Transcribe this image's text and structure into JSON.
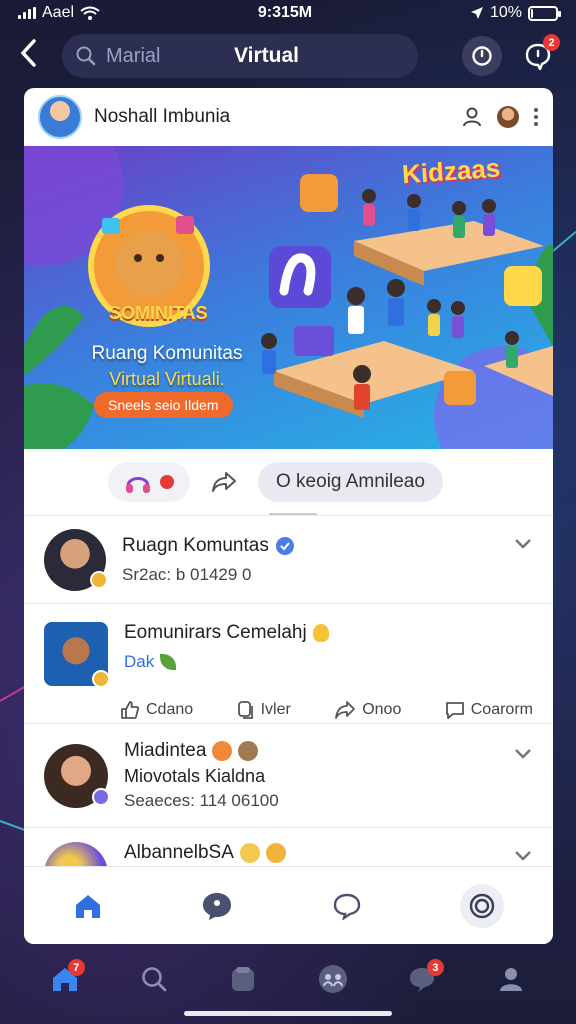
{
  "status_bar": {
    "carrier": "Aael",
    "time": "9:315M",
    "battery": "10%",
    "battery_level": 0.1
  },
  "top_nav": {
    "search_placeholder": "Marial",
    "title": "Virtual"
  },
  "post": {
    "group_name": "Noshall Imbunia",
    "banner": {
      "emblem_text": "SOMINITAS",
      "kids_text": "Kidzaas",
      "line1": "Ruang Komunitas",
      "line2": "Virtual Virtuali.",
      "cta": "Sneels seio Ildem"
    },
    "comment_placeholder": "O keoig Amnileao"
  },
  "feed": [
    {
      "name": "Ruagn Komuntas",
      "sub": "Sr2ac: b 01429 0",
      "verified": true
    },
    {
      "name": "Eomunirars Cemelahj",
      "sub": "Dak"
    },
    {
      "name": "Miadintea",
      "line2": "Miovotals Kialdna",
      "sub": "Seaeces: 114 06100"
    },
    {
      "name": "AlbannelbSA"
    }
  ],
  "reactions": [
    {
      "icon": "thumbs-up-icon",
      "label": "Cdano"
    },
    {
      "icon": "copy-icon",
      "label": "Ivler"
    },
    {
      "icon": "share-icon",
      "label": "Onoo"
    },
    {
      "icon": "comment-icon",
      "label": "Coarorm"
    }
  ],
  "notifications": {
    "nav_badge": "2",
    "home_badge": "7",
    "chat_badge": "3"
  },
  "colors": {
    "accent": "#2f6fe0",
    "badge": "#e53935",
    "background": "#1d1f3a"
  }
}
